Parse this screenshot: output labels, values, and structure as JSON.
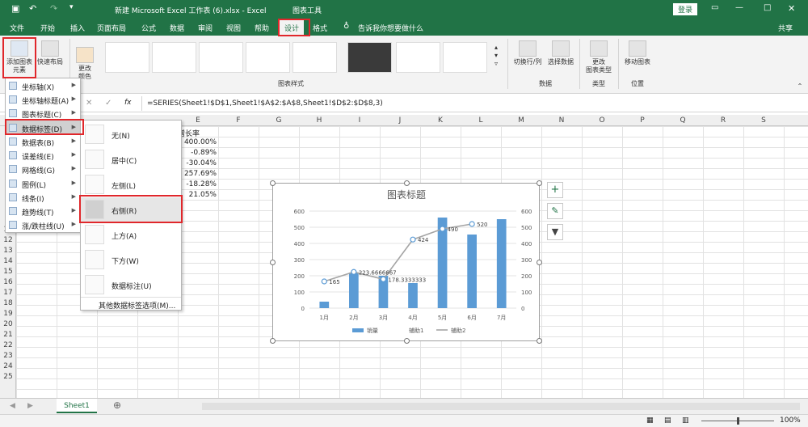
{
  "app": {
    "title": "新建 Microsoft Excel 工作表 (6).xlsx  -  Excel",
    "context_tab": "图表工具",
    "login": "登录"
  },
  "tabs": [
    "文件",
    "开始",
    "插入",
    "页面布局",
    "公式",
    "数据",
    "审阅",
    "视图",
    "帮助",
    "设计",
    "格式"
  ],
  "tell_me": "告诉我你想要做什么",
  "share": "共享",
  "ribbon": {
    "add_element": "添加图表元素",
    "add_element_l1": "添加图表",
    "add_element_l2": "元素",
    "quick_layout": "快速布局",
    "change_colors_l1": "更改",
    "change_colors_l2": "颜色",
    "group_styles": "图表样式",
    "switch_row_col": "切换行/列",
    "select_data": "选择数据",
    "group_data": "数据",
    "change_type_l1": "更改",
    "change_type_l2": "图表类型",
    "group_type": "类型",
    "move_chart": "移动图表",
    "group_location": "位置"
  },
  "formula": {
    "fx": "fx",
    "value": "=SERIES(Sheet1!$D$1,Sheet1!$A$2:$A$8,Sheet1!$D$2:$D$8,3)"
  },
  "columns": [
    "E",
    "F",
    "G",
    "H",
    "I",
    "J",
    "K",
    "L",
    "M",
    "N",
    "O",
    "P",
    "Q",
    "R",
    "S"
  ],
  "rows": [
    "11",
    "12",
    "13",
    "14",
    "15",
    "16",
    "17",
    "18",
    "19",
    "20",
    "21",
    "22",
    "23",
    "24",
    "25"
  ],
  "cells": {
    "e_header": "增长率",
    "e_values": [
      "400.00%",
      "-0.89%",
      "-30.04%",
      "257.69%",
      "-18.28%",
      "21.05%"
    ]
  },
  "menu": {
    "items": [
      {
        "label": "坐标轴(X)"
      },
      {
        "label": "坐标轴标题(A)"
      },
      {
        "label": "图表标题(C)"
      },
      {
        "label": "数据标签(D)"
      },
      {
        "label": "数据表(B)"
      },
      {
        "label": "误差线(E)"
      },
      {
        "label": "网格线(G)"
      },
      {
        "label": "图例(L)"
      },
      {
        "label": "线条(I)"
      },
      {
        "label": "趋势线(T)"
      },
      {
        "label": "涨/跌柱线(U)"
      }
    ]
  },
  "submenu": {
    "items": [
      "无(N)",
      "居中(C)",
      "左侧(L)",
      "右侧(R)",
      "上方(A)",
      "下方(W)",
      "数据标注(U)"
    ],
    "more": "其他数据标签选项(M)..."
  },
  "sheet": {
    "tab": "Sheet1"
  },
  "status": {
    "zoom": "100%"
  },
  "colors": {
    "excel_green": "#217346",
    "bar_blue": "#5b9bd5",
    "line_gray": "#a5a5a5",
    "highlight_red": "#e0272b"
  },
  "chart_data": {
    "type": "bar",
    "title": "图表标题",
    "categories": [
      "1月",
      "2月",
      "3月",
      "4月",
      "5月",
      "6月",
      "7月"
    ],
    "series": [
      {
        "name": "销量",
        "type": "bar",
        "values": [
          40,
          220,
          200,
          155,
          560,
          455,
          550
        ]
      },
      {
        "name": "辅助1",
        "type": "line",
        "values": [
          165,
          223.6666667,
          178.3333333,
          424,
          490,
          520,
          null
        ]
      },
      {
        "name": "辅助2",
        "type": "line",
        "values": [
          165,
          223.6666667,
          178.3333333,
          424,
          490,
          520,
          null
        ]
      }
    ],
    "data_labels": [
      "165",
      "223.6666667",
      "178.3333333",
      "424",
      "490",
      "520"
    ],
    "ylim": [
      0,
      600
    ],
    "yticks": [
      0,
      100,
      200,
      300,
      400,
      500,
      600
    ],
    "secondary_yticks": [
      0,
      100,
      200,
      300,
      400,
      500,
      600
    ],
    "legend": "bottom"
  }
}
